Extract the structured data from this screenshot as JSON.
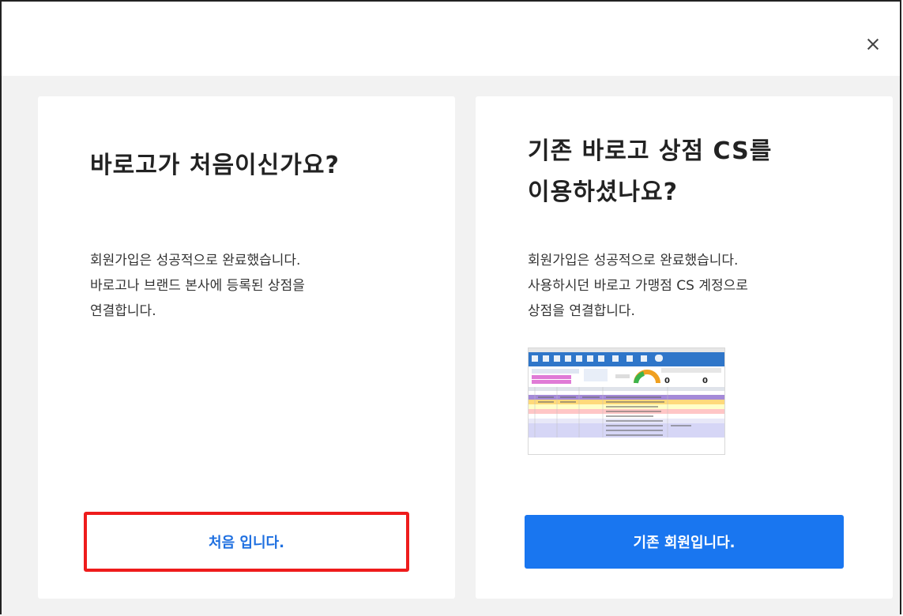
{
  "header": {
    "close_label": "×"
  },
  "left_card": {
    "title": "바로고가 처음이신가요?",
    "desc_lines": [
      "회원가입은 성공적으로 완료했습니다.",
      "바로고나 브랜드 본사에 등록된 상점을",
      "연결합니다."
    ],
    "button_label": "처음 입니다."
  },
  "right_card": {
    "title_lines": [
      "기존 바로고 상점 CS를",
      "이용하셨나요?"
    ],
    "desc_lines": [
      "회원가입은 성공적으로 완료했습니다.",
      "사용하시던 바로고 가맹점 CS 계정으로",
      "상점을 연결합니다."
    ],
    "preview_image": "barogo-cs-program-screenshot",
    "button_label": "기존 회원입니다."
  },
  "colors": {
    "primary": "#1976f0",
    "highlight_border": "#ee1c1c",
    "body_bg": "#f2f2f2"
  }
}
